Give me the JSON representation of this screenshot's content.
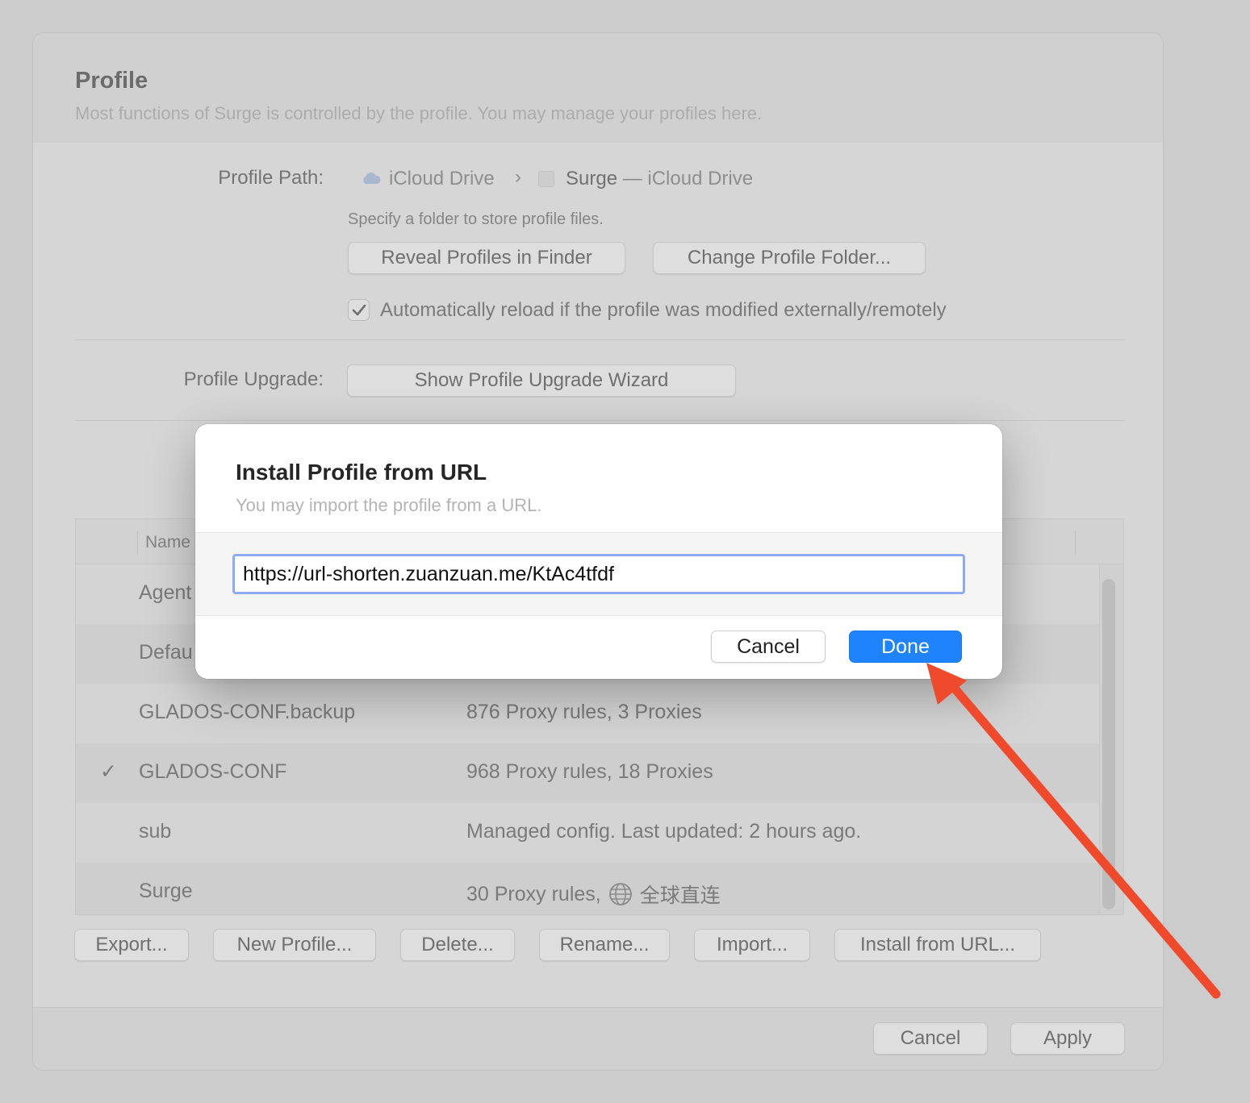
{
  "header": {
    "title": "Profile",
    "subtitle": "Most functions of Surge is controlled by the profile. You may manage your profiles here."
  },
  "profile_path": {
    "label": "Profile Path:",
    "segment1": "iCloud Drive",
    "chevron": "›",
    "segment2": "Surge",
    "segment2_suffix": "— iCloud Drive",
    "hint": "Specify a folder to store profile files.",
    "reveal_button": "Reveal Profiles in Finder",
    "change_button": "Change Profile Folder...",
    "auto_reload_label": "Automatically reload if the profile was modified externally/remotely",
    "auto_reload_checked": true
  },
  "profile_upgrade": {
    "label": "Profile Upgrade:",
    "button": "Show Profile Upgrade Wizard"
  },
  "table": {
    "header_name": "Name",
    "rows": [
      {
        "name": "Agent",
        "desc": "",
        "active": false
      },
      {
        "name": "Defau",
        "desc": "",
        "active": false
      },
      {
        "name": "GLADOS-CONF.backup",
        "desc": "876 Proxy rules, 3 Proxies",
        "active": false
      },
      {
        "name": "GLADOS-CONF",
        "desc": "968 Proxy rules, 18 Proxies",
        "active": true,
        "check": "✓"
      },
      {
        "name": "sub",
        "desc": "Managed config. Last updated: 2 hours ago.",
        "active": false
      },
      {
        "name": "Surge",
        "desc": "30 Proxy rules,",
        "desc_suffix": "全球直连",
        "icon": "globe-icon",
        "active": false
      }
    ]
  },
  "actions": {
    "export": "Export...",
    "new_profile": "New Profile...",
    "delete": "Delete...",
    "rename": "Rename...",
    "import": "Import...",
    "install_url": "Install from URL..."
  },
  "footer": {
    "cancel": "Cancel",
    "apply": "Apply"
  },
  "dialog": {
    "title": "Install Profile from URL",
    "subtitle": "You may import the profile from a URL.",
    "url_value": "https://url-shorten.zuanzuan.me/KtAc4tfdf",
    "cancel": "Cancel",
    "done": "Done"
  },
  "colors": {
    "accent": "#1f84fb",
    "focus_ring": "#8eaaf5",
    "annotation_arrow": "#f04a2d"
  }
}
